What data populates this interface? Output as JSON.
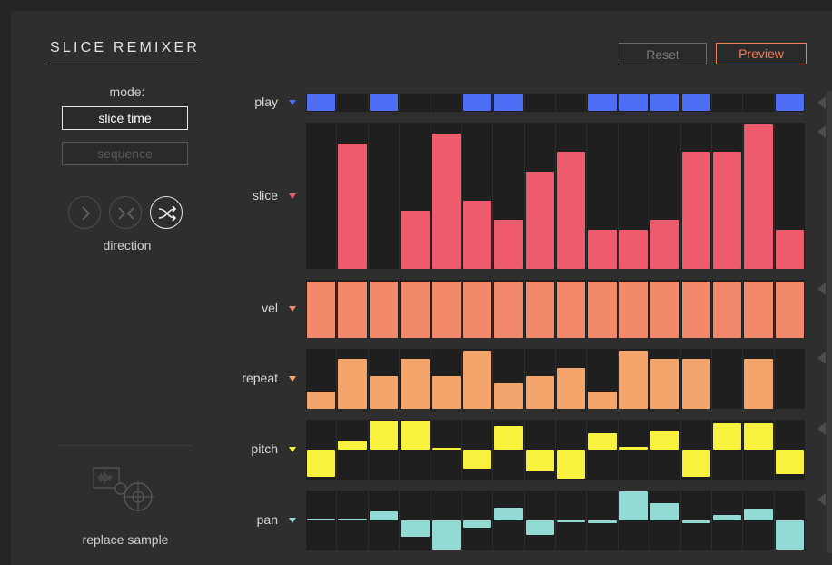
{
  "app": {
    "title": "SLICE REMIXER"
  },
  "header": {
    "reset_label": "Reset",
    "preview_label": "Preview"
  },
  "mode": {
    "label": "mode:",
    "options": [
      "slice time",
      "sequence"
    ],
    "selected": "slice time"
  },
  "direction": {
    "label": "direction",
    "options": [
      "forward-icon",
      "inward-icon",
      "shuffle-icon"
    ],
    "selected": "shuffle-icon"
  },
  "sample": {
    "replace_label": "replace sample"
  },
  "colors": {
    "play": "#4d6ef5",
    "slice": "#ee5b6c",
    "vel": "#f2896a",
    "repeat": "#f3a56b",
    "pitch": "#f8f23e",
    "pan": "#93d9d4",
    "preview_accent": "#f27d5a"
  },
  "lanes": [
    {
      "id": "play",
      "label": "play",
      "arrow": "#4a70f5",
      "type": "toggle",
      "values": [
        1,
        0,
        1,
        0,
        0,
        1,
        1,
        0,
        0,
        1,
        1,
        1,
        1,
        0,
        0,
        1
      ]
    },
    {
      "id": "slice",
      "label": "slice",
      "arrow": "#ee5b6c",
      "type": "bar",
      "values": [
        0,
        0.87,
        0,
        0.4,
        0.94,
        0.47,
        0.34,
        0.67,
        0.81,
        0.27,
        0.27,
        0.34,
        0.81,
        0.81,
        1.0,
        0.27
      ]
    },
    {
      "id": "vel",
      "label": "vel",
      "arrow": "#f2896a",
      "type": "bar",
      "values": [
        1,
        1,
        1,
        1,
        1,
        1,
        1,
        1,
        1,
        1,
        1,
        1,
        1,
        1,
        1,
        1
      ]
    },
    {
      "id": "repeat",
      "label": "repeat",
      "arrow": "#f3a56b",
      "type": "bar",
      "values": [
        0.29,
        0.86,
        0.57,
        0.86,
        0.57,
        1.0,
        0.43,
        0.57,
        0.71,
        0.29,
        1.0,
        0.86,
        0.86,
        0,
        0.86,
        0
      ]
    },
    {
      "id": "pitch",
      "label": "pitch",
      "arrow": "#f8f23e",
      "type": "bipolar",
      "values": [
        -0.95,
        0.3,
        1.0,
        1.0,
        0.05,
        -0.65,
        0.8,
        -0.75,
        -1.0,
        0.55,
        0.1,
        0.65,
        -0.95,
        0.9,
        0.9,
        -0.85
      ]
    },
    {
      "id": "pan",
      "label": "pan",
      "arrow": "#93d9d4",
      "type": "bipolar",
      "values": [
        0.05,
        0.07,
        0.3,
        -0.55,
        -1.0,
        -0.25,
        0.45,
        -0.5,
        -0.05,
        -0.1,
        1.0,
        0.6,
        -0.1,
        0.2,
        0.4,
        -1.0
      ]
    }
  ]
}
